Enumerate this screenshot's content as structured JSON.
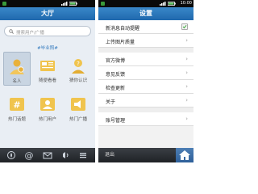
{
  "left": {
    "status": {
      "time": ""
    },
    "title": "大厅",
    "search": {
      "placeholder": "搜索用户/广播"
    },
    "tagline": "#毕业照#",
    "grid": [
      {
        "label": "名人",
        "icon": "person-icon",
        "selected": true
      },
      {
        "label": "随便看看",
        "icon": "browse-icon",
        "selected": false
      },
      {
        "label": "猜你认识",
        "icon": "question-person-icon",
        "selected": false
      },
      {
        "label": "热门话题",
        "icon": "hashtag-icon",
        "selected": false
      },
      {
        "label": "热门用户",
        "icon": "users-icon",
        "selected": false
      },
      {
        "label": "热门广播",
        "icon": "broadcast-icon",
        "selected": false
      }
    ],
    "bottom_icons": [
      "fire-icon",
      "at-icon",
      "mail-icon",
      "user-icon",
      "menu-icon"
    ]
  },
  "right": {
    "status": {
      "time": "10:00"
    },
    "title": "设置",
    "rows": [
      {
        "label": "新消息自动提醒",
        "kind": "check"
      },
      {
        "label": "上传图片质量",
        "kind": "chevron"
      },
      {
        "label": "官方微博",
        "kind": "chevron"
      },
      {
        "label": "意见反馈",
        "kind": "chevron"
      },
      {
        "label": "检查更新",
        "kind": "chevron"
      },
      {
        "label": "关于",
        "kind": "chevron"
      },
      {
        "label": "账号管理",
        "kind": "chevron"
      }
    ],
    "exit_label": "退出",
    "home_icon": "home-icon"
  },
  "colors": {
    "title_blue": "#2a78be",
    "accent_blue": "#3b7fc0",
    "bar_dark": "#2a2d31"
  }
}
